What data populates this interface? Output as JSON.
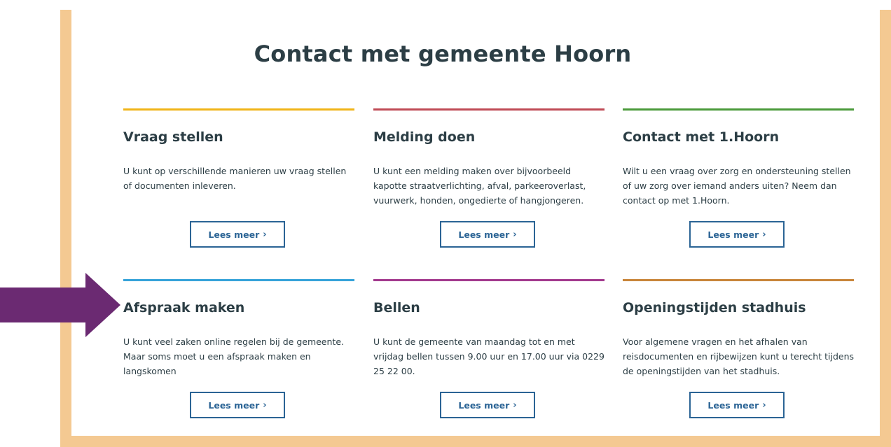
{
  "page_title": "Contact met gemeente Hoorn",
  "cards": [
    {
      "title": "Vraag stellen",
      "text": "U kunt op verschillende manieren uw vraag stellen of documenten inleveren.",
      "button": "Lees meer",
      "color": "#f0b418"
    },
    {
      "title": "Melding doen",
      "text": "U kunt een melding maken over bijvoorbeeld kapotte straatverlichting, afval, parkeeroverlast, vuurwerk, honden, ongedierte of hangjongeren.",
      "button": "Lees meer",
      "color": "#bf4a55"
    },
    {
      "title": "Contact met 1.Hoorn",
      "text": "Wilt u een vraag over zorg en ondersteuning stellen of uw zorg over iemand anders uiten? Neem dan contact op met 1.Hoorn.",
      "button": "Lees meer",
      "color": "#4a9a3a"
    },
    {
      "title": "Afspraak maken",
      "text": "U kunt veel zaken online regelen bij de gemeente. Maar soms moet u een afspraak maken en langskomen",
      "button": "Lees meer",
      "color": "#36a3d9"
    },
    {
      "title": "Bellen",
      "text": "U kunt de gemeente van maandag tot en met vrijdag bellen tussen 9.00 uur en 17.00 uur via 0229 25 22 00.",
      "button": "Lees meer",
      "color": "#a33a8e"
    },
    {
      "title": "Openingstijden stadhuis",
      "text": "Voor algemene vragen en het afhalen van reisdocumenten en rijbewijzen kunt u terecht tijdens de openingstijden van het stadhuis.",
      "button": "Lees meer",
      "color": "#c8853a"
    }
  ],
  "colors": {
    "frame": "#f4c992",
    "button": "#2b6495",
    "text": "#2c3e45",
    "arrow": "#6b2a72"
  },
  "icons": {
    "button_chevron": "chevron-right-icon",
    "annotation": "arrow-right-icon"
  }
}
